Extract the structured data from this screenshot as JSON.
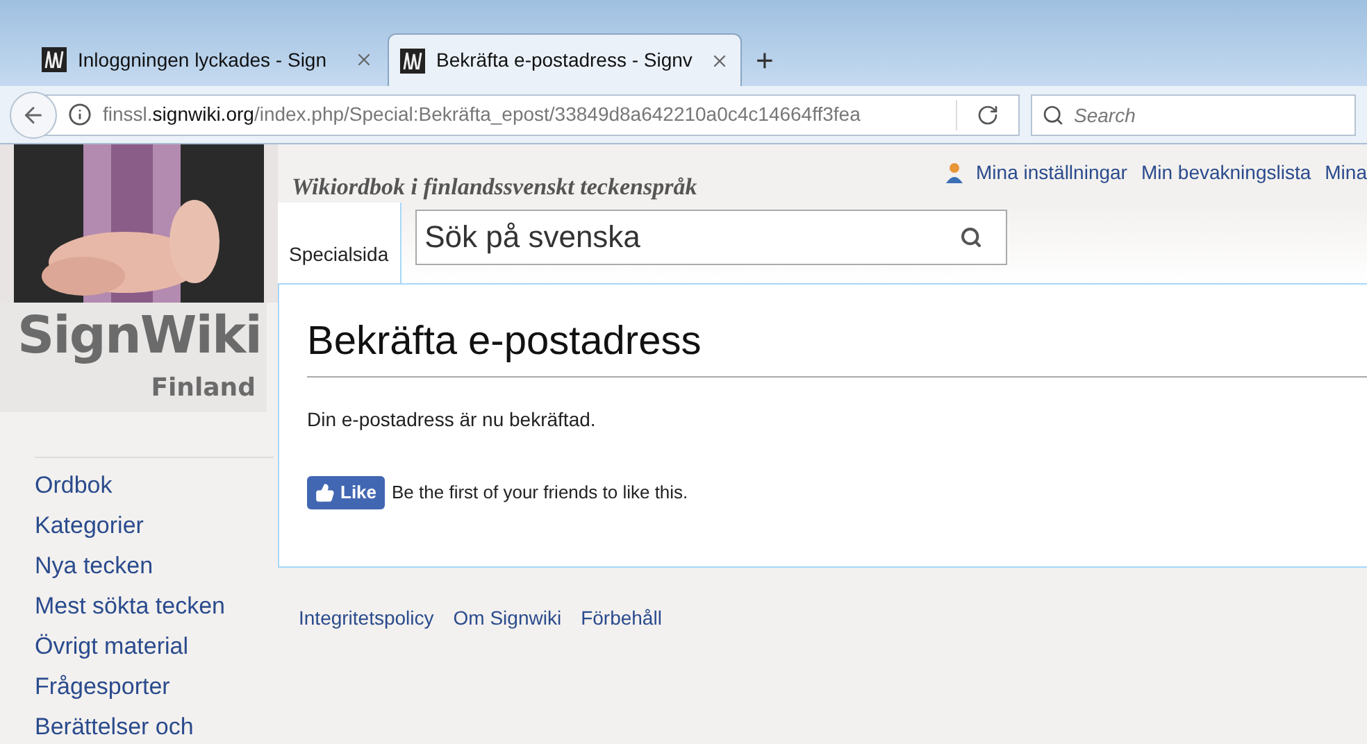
{
  "browser": {
    "tabs": [
      {
        "title": "Inloggningen lyckades - Sign",
        "selected": false
      },
      {
        "title": "Bekräfta e-postadress - Signv",
        "selected": true
      }
    ],
    "new_tab": "+",
    "address": {
      "scheme": "finssl.",
      "host": "signwiki.org",
      "path": "/index.php/Special:Bekräfta_epost/33849d8a642210a0c4c14664ff3fea"
    },
    "search": {
      "placeholder": "Search"
    }
  },
  "logo": {
    "title": "SignWiki",
    "subtitle": "Finland"
  },
  "site_tagline": "Wikiordbok i finlandssvenskt teckenspråk",
  "personal_links": [
    "Mina inställningar",
    "Min bevakningslista",
    "Mina"
  ],
  "namespace_tab": {
    "label": "Specialsida",
    "selected": true
  },
  "wiki_search": {
    "placeholder": "Sök på svenska"
  },
  "page": {
    "heading": "Bekräfta e-postadress",
    "message": "Din e-postadress är nu bekräftad.",
    "like_button": "Like",
    "like_text": "Be the first of your friends to like this."
  },
  "sidebar": {
    "items": [
      "Ordbok",
      "Kategorier",
      "Nya tecken",
      "Mest sökta tecken",
      "Övrigt material",
      "Frågesporter",
      "Berättelser och"
    ]
  },
  "footer_links": [
    "Integritetspolicy",
    "Om Signwiki",
    "Förbehåll"
  ]
}
